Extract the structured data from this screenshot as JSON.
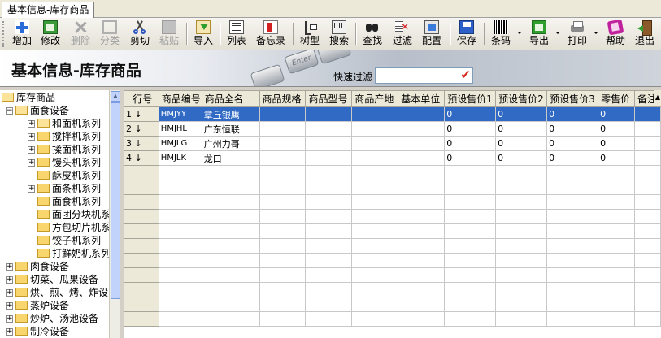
{
  "tab": {
    "label": "基本信息-库存商品"
  },
  "toolbar": {
    "items": [
      {
        "label": "增加",
        "icon": "add-icon",
        "enabled": true
      },
      {
        "label": "修改",
        "icon": "edit-icon",
        "enabled": true
      },
      {
        "label": "删除",
        "icon": "delete-icon",
        "enabled": false
      },
      {
        "label": "分类",
        "icon": "category-icon",
        "enabled": false
      },
      {
        "label": "剪切",
        "icon": "scissors-icon",
        "enabled": true
      },
      {
        "label": "粘贴",
        "icon": "paste-icon",
        "enabled": false
      },
      {
        "label": "导入",
        "icon": "import-icon",
        "enabled": true
      },
      {
        "label": "列表",
        "icon": "list-icon",
        "enabled": true
      },
      {
        "label": "备忘录",
        "icon": "memo-icon",
        "enabled": true
      },
      {
        "label": "树型",
        "icon": "tree-icon",
        "enabled": true
      },
      {
        "label": "搜索",
        "icon": "search-icon",
        "enabled": true
      },
      {
        "label": "查找",
        "icon": "binoculars-icon",
        "enabled": true
      },
      {
        "label": "过滤",
        "icon": "filter-icon",
        "enabled": true
      },
      {
        "label": "配置",
        "icon": "config-icon",
        "enabled": true
      },
      {
        "label": "保存",
        "icon": "save-icon",
        "enabled": true
      },
      {
        "label": "条码",
        "icon": "barcode-icon",
        "enabled": true
      },
      {
        "label": "导出",
        "icon": "export-icon",
        "enabled": true
      },
      {
        "label": "打印",
        "icon": "printer-icon",
        "enabled": true
      },
      {
        "label": "帮助",
        "icon": "help-icon",
        "enabled": true
      },
      {
        "label": "退出",
        "icon": "exit-icon",
        "enabled": true
      }
    ]
  },
  "header": {
    "title": "基本信息-库存商品",
    "quick_filter_label": "快速过滤",
    "quick_filter_value": "",
    "banner_key_text": "Enter"
  },
  "tree": {
    "root": "库存商品",
    "nodes": [
      {
        "label": "面食设备",
        "expanded": true
      },
      {
        "label": "和面机系列"
      },
      {
        "label": "搅拌机系列"
      },
      {
        "label": "揉面机系列"
      },
      {
        "label": "馒头机系列"
      },
      {
        "label": "酥皮机系列"
      },
      {
        "label": "面条机系列"
      },
      {
        "label": "面食机系列"
      },
      {
        "label": "面团分块机系"
      },
      {
        "label": "方包切片机系"
      },
      {
        "label": "饺子机系列"
      },
      {
        "label": "打鲜奶机系列"
      },
      {
        "label": "肉食设备"
      },
      {
        "label": "切菜、瓜果设备"
      },
      {
        "label": "烘、煎、烤、炸设"
      },
      {
        "label": "蒸炉设备"
      },
      {
        "label": "炒炉、汤池设备"
      },
      {
        "label": "制冷设备"
      }
    ]
  },
  "grid": {
    "columns": [
      "行号",
      "商品编号",
      "商品全名",
      "商品规格",
      "商品型号",
      "商品产地",
      "基本单位",
      "预设售价1",
      "预设售价2",
      "预设售价3",
      "零售价",
      "备注"
    ],
    "rows": [
      {
        "rownum": "1",
        "code": "HMJYY",
        "name": "章丘银鹰",
        "p1": "0",
        "p2": "0",
        "p3": "0",
        "retail": "0"
      },
      {
        "rownum": "2",
        "code": "HMJHL",
        "name": "广东恒联",
        "p1": "0",
        "p2": "0",
        "p3": "0",
        "retail": "0"
      },
      {
        "rownum": "3",
        "code": "HMJLG",
        "name": "广州力哥",
        "p1": "0",
        "p2": "0",
        "p3": "0",
        "retail": "0"
      },
      {
        "rownum": "4",
        "code": "HMJLK",
        "name": "龙口",
        "p1": "0",
        "p2": "0",
        "p3": "0",
        "retail": "0"
      }
    ],
    "selected_row": 1,
    "row_marker": "↓"
  },
  "colors": {
    "selection": "#316ac5",
    "window_bg": "#d4d0c8",
    "folder": "#f8d66d"
  }
}
